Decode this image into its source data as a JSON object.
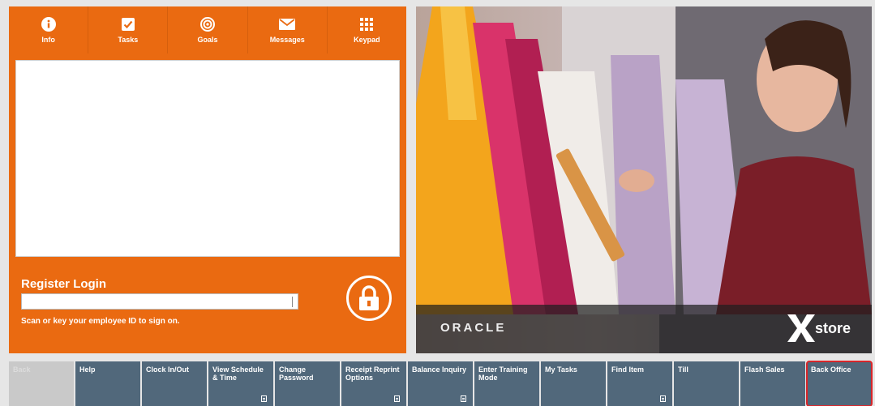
{
  "tabs": [
    {
      "label": "Info",
      "icon": "info-icon"
    },
    {
      "label": "Tasks",
      "icon": "checkbox-icon"
    },
    {
      "label": "Goals",
      "icon": "target-icon"
    },
    {
      "label": "Messages",
      "icon": "envelope-icon"
    },
    {
      "label": "Keypad",
      "icon": "keypad-icon"
    }
  ],
  "login": {
    "title": "Register Login",
    "hint": "Scan or key your employee ID to sign on.",
    "input_value": ""
  },
  "branding": {
    "oracle": "ORACLE",
    "xstore": "store"
  },
  "function_buttons": [
    {
      "label": "Back",
      "state": "disabled"
    },
    {
      "label": "Help"
    },
    {
      "label": "Clock In/Out"
    },
    {
      "label": "View Schedule & Time",
      "has_submenu": true
    },
    {
      "label": "Change Password"
    },
    {
      "label": "Receipt Reprint Options",
      "has_submenu": true
    },
    {
      "label": "Balance Inquiry",
      "has_submenu": true
    },
    {
      "label": "Enter Training Mode"
    },
    {
      "label": "My Tasks"
    },
    {
      "label": "Find Item",
      "has_submenu": true
    },
    {
      "label": "Till"
    },
    {
      "label": "Flash Sales"
    },
    {
      "label": "Back Office",
      "highlighted": true
    }
  ],
  "colors": {
    "accent_orange": "#ea6a11",
    "button_blue": "#51687b",
    "highlight_red": "#d8262a"
  }
}
